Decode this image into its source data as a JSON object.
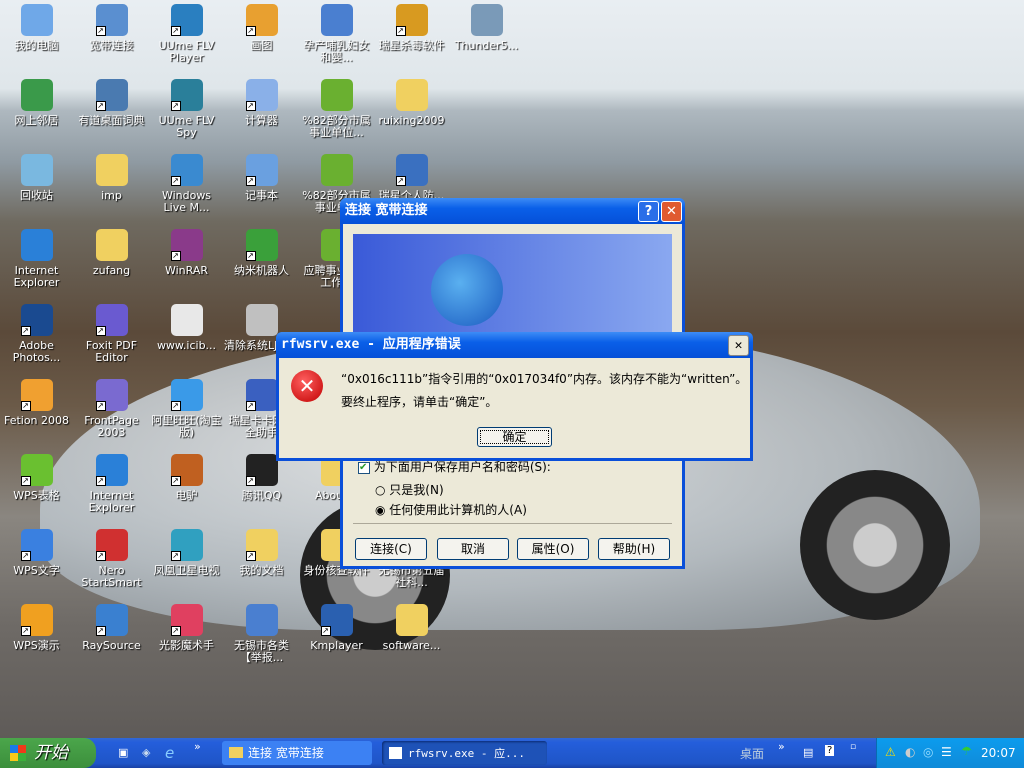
{
  "desktop": {
    "icons": [
      {
        "label": "我的电脑",
        "col": 0,
        "row": 0,
        "color": "#6fa8e8",
        "shortcut": false
      },
      {
        "label": "宽带连接",
        "col": 1,
        "row": 0,
        "color": "#5a8fd0",
        "shortcut": true
      },
      {
        "label": "UUme FLV Player",
        "col": 2,
        "row": 0,
        "color": "#2a7fc0",
        "shortcut": true
      },
      {
        "label": "画图",
        "col": 3,
        "row": 0,
        "color": "#e8a030",
        "shortcut": true
      },
      {
        "label": "孕产哺乳妇女和婴...",
        "col": 4,
        "row": 0,
        "color": "#4a7fd0",
        "shortcut": false
      },
      {
        "label": "瑞星杀毒软件",
        "col": 5,
        "row": 0,
        "color": "#d89a20",
        "shortcut": true
      },
      {
        "label": "Thunder5...",
        "col": 6,
        "row": 0,
        "color": "#7a9ab8",
        "shortcut": false
      },
      {
        "label": "网上邻居",
        "col": 0,
        "row": 1,
        "color": "#3a9a4a",
        "shortcut": false
      },
      {
        "label": "有道桌面词典",
        "col": 1,
        "row": 1,
        "color": "#4a7ab0",
        "shortcut": true
      },
      {
        "label": "UUme FLV Spy",
        "col": 2,
        "row": 1,
        "color": "#2a7f9a",
        "shortcut": true
      },
      {
        "label": "计算器",
        "col": 3,
        "row": 1,
        "color": "#8ab0e8",
        "shortcut": true
      },
      {
        "label": "%82部分市属事业单位...",
        "col": 4,
        "row": 1,
        "color": "#6ab030",
        "shortcut": false
      },
      {
        "label": "ruixing2009",
        "col": 5,
        "row": 1,
        "color": "#f0d060",
        "shortcut": false
      },
      {
        "label": "回收站",
        "col": 0,
        "row": 2,
        "color": "#7ab8e0",
        "shortcut": false
      },
      {
        "label": "imp",
        "col": 1,
        "row": 2,
        "color": "#f0d060",
        "shortcut": false
      },
      {
        "label": "Windows Live M...",
        "col": 2,
        "row": 2,
        "color": "#3a8ad0",
        "shortcut": true
      },
      {
        "label": "记事本",
        "col": 3,
        "row": 2,
        "color": "#6aa0e0",
        "shortcut": true
      },
      {
        "label": "%82部分市属事业单...",
        "col": 4,
        "row": 2,
        "color": "#6ab030",
        "shortcut": false
      },
      {
        "label": "瑞星个人防...",
        "col": 5,
        "row": 2,
        "color": "#3a70c0",
        "shortcut": true
      },
      {
        "label": "Internet Explorer",
        "col": 0,
        "row": 3,
        "color": "#2a80d8",
        "shortcut": false
      },
      {
        "label": "zufang",
        "col": 1,
        "row": 3,
        "color": "#f0d060",
        "shortcut": false
      },
      {
        "label": "WinRAR",
        "col": 2,
        "row": 3,
        "color": "#8a3a8a",
        "shortcut": true
      },
      {
        "label": "纳米机器人",
        "col": 3,
        "row": 3,
        "color": "#3aa03a",
        "shortcut": true
      },
      {
        "label": "应聘事业单位工作...",
        "col": 4,
        "row": 3,
        "color": "#6ab030",
        "shortcut": false
      },
      {
        "label": "Adobe Photos...",
        "col": 0,
        "row": 4,
        "color": "#1a4a90",
        "shortcut": true
      },
      {
        "label": "Foxit PDF Editor",
        "col": 1,
        "row": 4,
        "color": "#6a5ad0",
        "shortcut": true
      },
      {
        "label": "www.icib...",
        "col": 2,
        "row": 4,
        "color": "#e8e8e8",
        "shortcut": false
      },
      {
        "label": "清除系统LJ.bat",
        "col": 3,
        "row": 4,
        "color": "#c0c0c0",
        "shortcut": false
      },
      {
        "label": "Fetion 2008",
        "col": 0,
        "row": 5,
        "color": "#f0a030",
        "shortcut": true
      },
      {
        "label": "FrontPage 2003",
        "col": 1,
        "row": 5,
        "color": "#7a6ad0",
        "shortcut": true
      },
      {
        "label": "阿里旺旺(淘宝版)",
        "col": 2,
        "row": 5,
        "color": "#3a9ae8",
        "shortcut": true
      },
      {
        "label": "瑞星卡卡网安全助手",
        "col": 3,
        "row": 5,
        "color": "#3a60c0",
        "shortcut": true
      },
      {
        "label": "WPS表格",
        "col": 0,
        "row": 6,
        "color": "#6ac030",
        "shortcut": true
      },
      {
        "label": "Internet Explorer",
        "col": 1,
        "row": 6,
        "color": "#2a80d8",
        "shortcut": true
      },
      {
        "label": "电驴",
        "col": 2,
        "row": 6,
        "color": "#c06020",
        "shortcut": true
      },
      {
        "label": "腾讯QQ",
        "col": 3,
        "row": 6,
        "color": "#222222",
        "shortcut": true
      },
      {
        "label": "About...",
        "col": 4,
        "row": 6,
        "color": "#f0d060",
        "shortcut": false
      },
      {
        "label": "WPS文字",
        "col": 0,
        "row": 7,
        "color": "#3a80e0",
        "shortcut": true
      },
      {
        "label": "Nero StartSmart",
        "col": 1,
        "row": 7,
        "color": "#d03030",
        "shortcut": true
      },
      {
        "label": "凤凰卫星电视",
        "col": 2,
        "row": 7,
        "color": "#30a0c0",
        "shortcut": true
      },
      {
        "label": "我的文档",
        "col": 3,
        "row": 7,
        "color": "#f0d060",
        "shortcut": true
      },
      {
        "label": "身份核查软件",
        "col": 4,
        "row": 7,
        "color": "#f0d060",
        "shortcut": false
      },
      {
        "label": "无锡市第五届社科...",
        "col": 5,
        "row": 7,
        "color": "#f0d060",
        "shortcut": false
      },
      {
        "label": "WPS演示",
        "col": 0,
        "row": 8,
        "color": "#f0a020",
        "shortcut": true
      },
      {
        "label": "RaySource",
        "col": 1,
        "row": 8,
        "color": "#3a80d0",
        "shortcut": true
      },
      {
        "label": "光影魔术手",
        "col": 2,
        "row": 8,
        "color": "#e04060",
        "shortcut": true
      },
      {
        "label": "无锡市各类【举报...",
        "col": 3,
        "row": 8,
        "color": "#4a7fd0",
        "shortcut": false
      },
      {
        "label": "Kmplayer",
        "col": 4,
        "row": 8,
        "color": "#2a60b0",
        "shortcut": true
      },
      {
        "label": "software...",
        "col": 5,
        "row": 8,
        "color": "#f0d060",
        "shortcut": false
      }
    ]
  },
  "connect_dialog": {
    "title": "连接 宽带连接",
    "help": "?",
    "close": "✕",
    "save_password": "为下面用户保存用户名和密码(S):",
    "radio_me": "只是我(N)",
    "radio_anyone": "任何使用此计算机的人(A)",
    "buttons": [
      "连接(C)",
      "取消",
      "属性(O)",
      "帮助(H)"
    ]
  },
  "error_dialog": {
    "title": "rfwsrv.exe - 应用程序错误",
    "close": "✕",
    "message": "“0x016c111b”指令引用的“0x017034f0”内存。该内存不能为“written”。",
    "message2": "要终止程序，请单击“确定”。",
    "ok": "确定"
  },
  "taskbar": {
    "start": "开始",
    "chevron": "»",
    "tasks": [
      "连接 宽带连接",
      "rfwsrv.exe - 应..."
    ],
    "desktop_toolbar": "桌面",
    "clock": "20:07"
  }
}
